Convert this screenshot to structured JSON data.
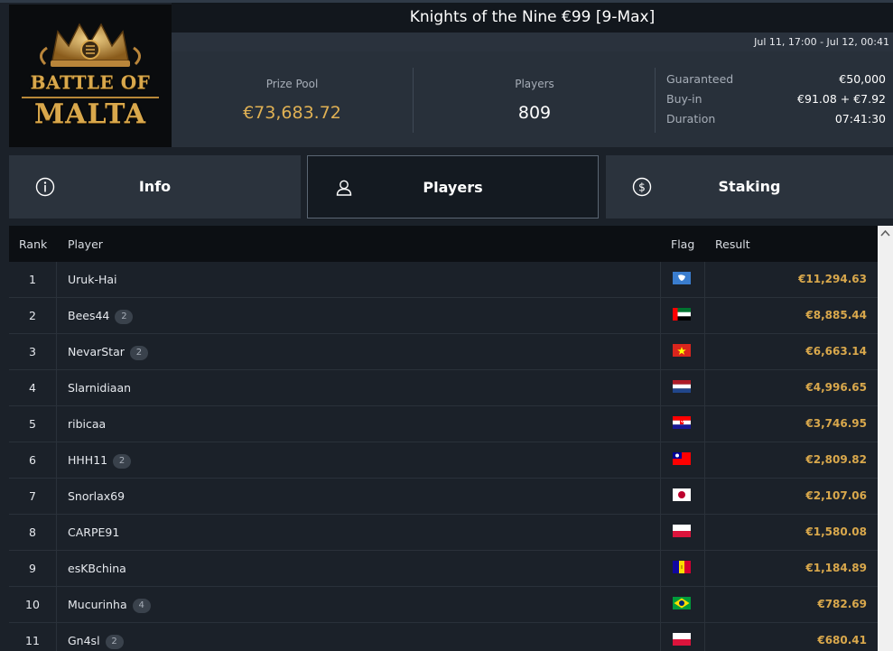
{
  "logo": {
    "line1": "BATTLE OF",
    "line2": "MALTA"
  },
  "tournament": {
    "title": "Knights of the Nine €99 [9-Max]",
    "dates": "Jul 11, 17:00 - Jul 12, 00:41"
  },
  "stats": {
    "prize_pool_label": "Prize Pool",
    "prize_pool": "€73,683.72",
    "players_label": "Players",
    "players": "809",
    "details": [
      {
        "label": "Guaranteed",
        "value": "€50,000"
      },
      {
        "label": "Buy-in",
        "value": "€91.08 + €7.92"
      },
      {
        "label": "Duration",
        "value": "07:41:30"
      }
    ]
  },
  "tabs": [
    {
      "label": "Info",
      "icon": "info-icon"
    },
    {
      "label": "Players",
      "icon": "user-icon",
      "active": true
    },
    {
      "label": "Staking",
      "icon": "dollar-coin-icon"
    }
  ],
  "table": {
    "headers": {
      "rank": "Rank",
      "player": "Player",
      "flag": "Flag",
      "result": "Result"
    },
    "rows": [
      {
        "rank": "1",
        "player": "Uruk-Hai",
        "badge": "",
        "flag": "antarctica",
        "result": "€11,294.63"
      },
      {
        "rank": "2",
        "player": "Bees44",
        "badge": "2",
        "flag": "uae",
        "result": "€8,885.44"
      },
      {
        "rank": "3",
        "player": "NevarStar",
        "badge": "2",
        "flag": "vietnam",
        "result": "€6,663.14"
      },
      {
        "rank": "4",
        "player": "Slarnidiaan",
        "badge": "",
        "flag": "netherlands",
        "result": "€4,996.65"
      },
      {
        "rank": "5",
        "player": "ribicaa",
        "badge": "",
        "flag": "croatia",
        "result": "€3,746.95"
      },
      {
        "rank": "6",
        "player": "HHH11",
        "badge": "2",
        "flag": "taiwan",
        "result": "€2,809.82"
      },
      {
        "rank": "7",
        "player": "Snorlax69",
        "badge": "",
        "flag": "japan",
        "result": "€2,107.06"
      },
      {
        "rank": "8",
        "player": "CARPE91",
        "badge": "",
        "flag": "poland",
        "result": "€1,580.08"
      },
      {
        "rank": "9",
        "player": "esKBchina",
        "badge": "",
        "flag": "andorra",
        "result": "€1,184.89"
      },
      {
        "rank": "10",
        "player": "Mucurinha",
        "badge": "4",
        "flag": "brazil",
        "result": "€782.69"
      },
      {
        "rank": "11",
        "player": "Gn4sl",
        "badge": "2",
        "flag": "poland",
        "result": "€680.41"
      }
    ]
  },
  "colors": {
    "accent_gold": "#d9a84c",
    "background": "#1b2129",
    "header_dark": "#0c0f13"
  }
}
